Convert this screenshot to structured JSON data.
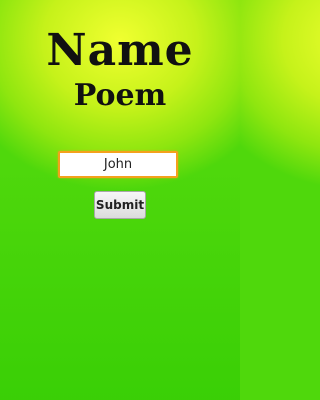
{
  "header": {
    "title_line1": "Name",
    "title_line2": "Poem"
  },
  "form": {
    "name_value": "John",
    "submit_label": "Submit"
  },
  "colors": {
    "input_border": "#f4a11c",
    "background_top": "#f0ff30",
    "background_bottom": "#4fd80c"
  }
}
